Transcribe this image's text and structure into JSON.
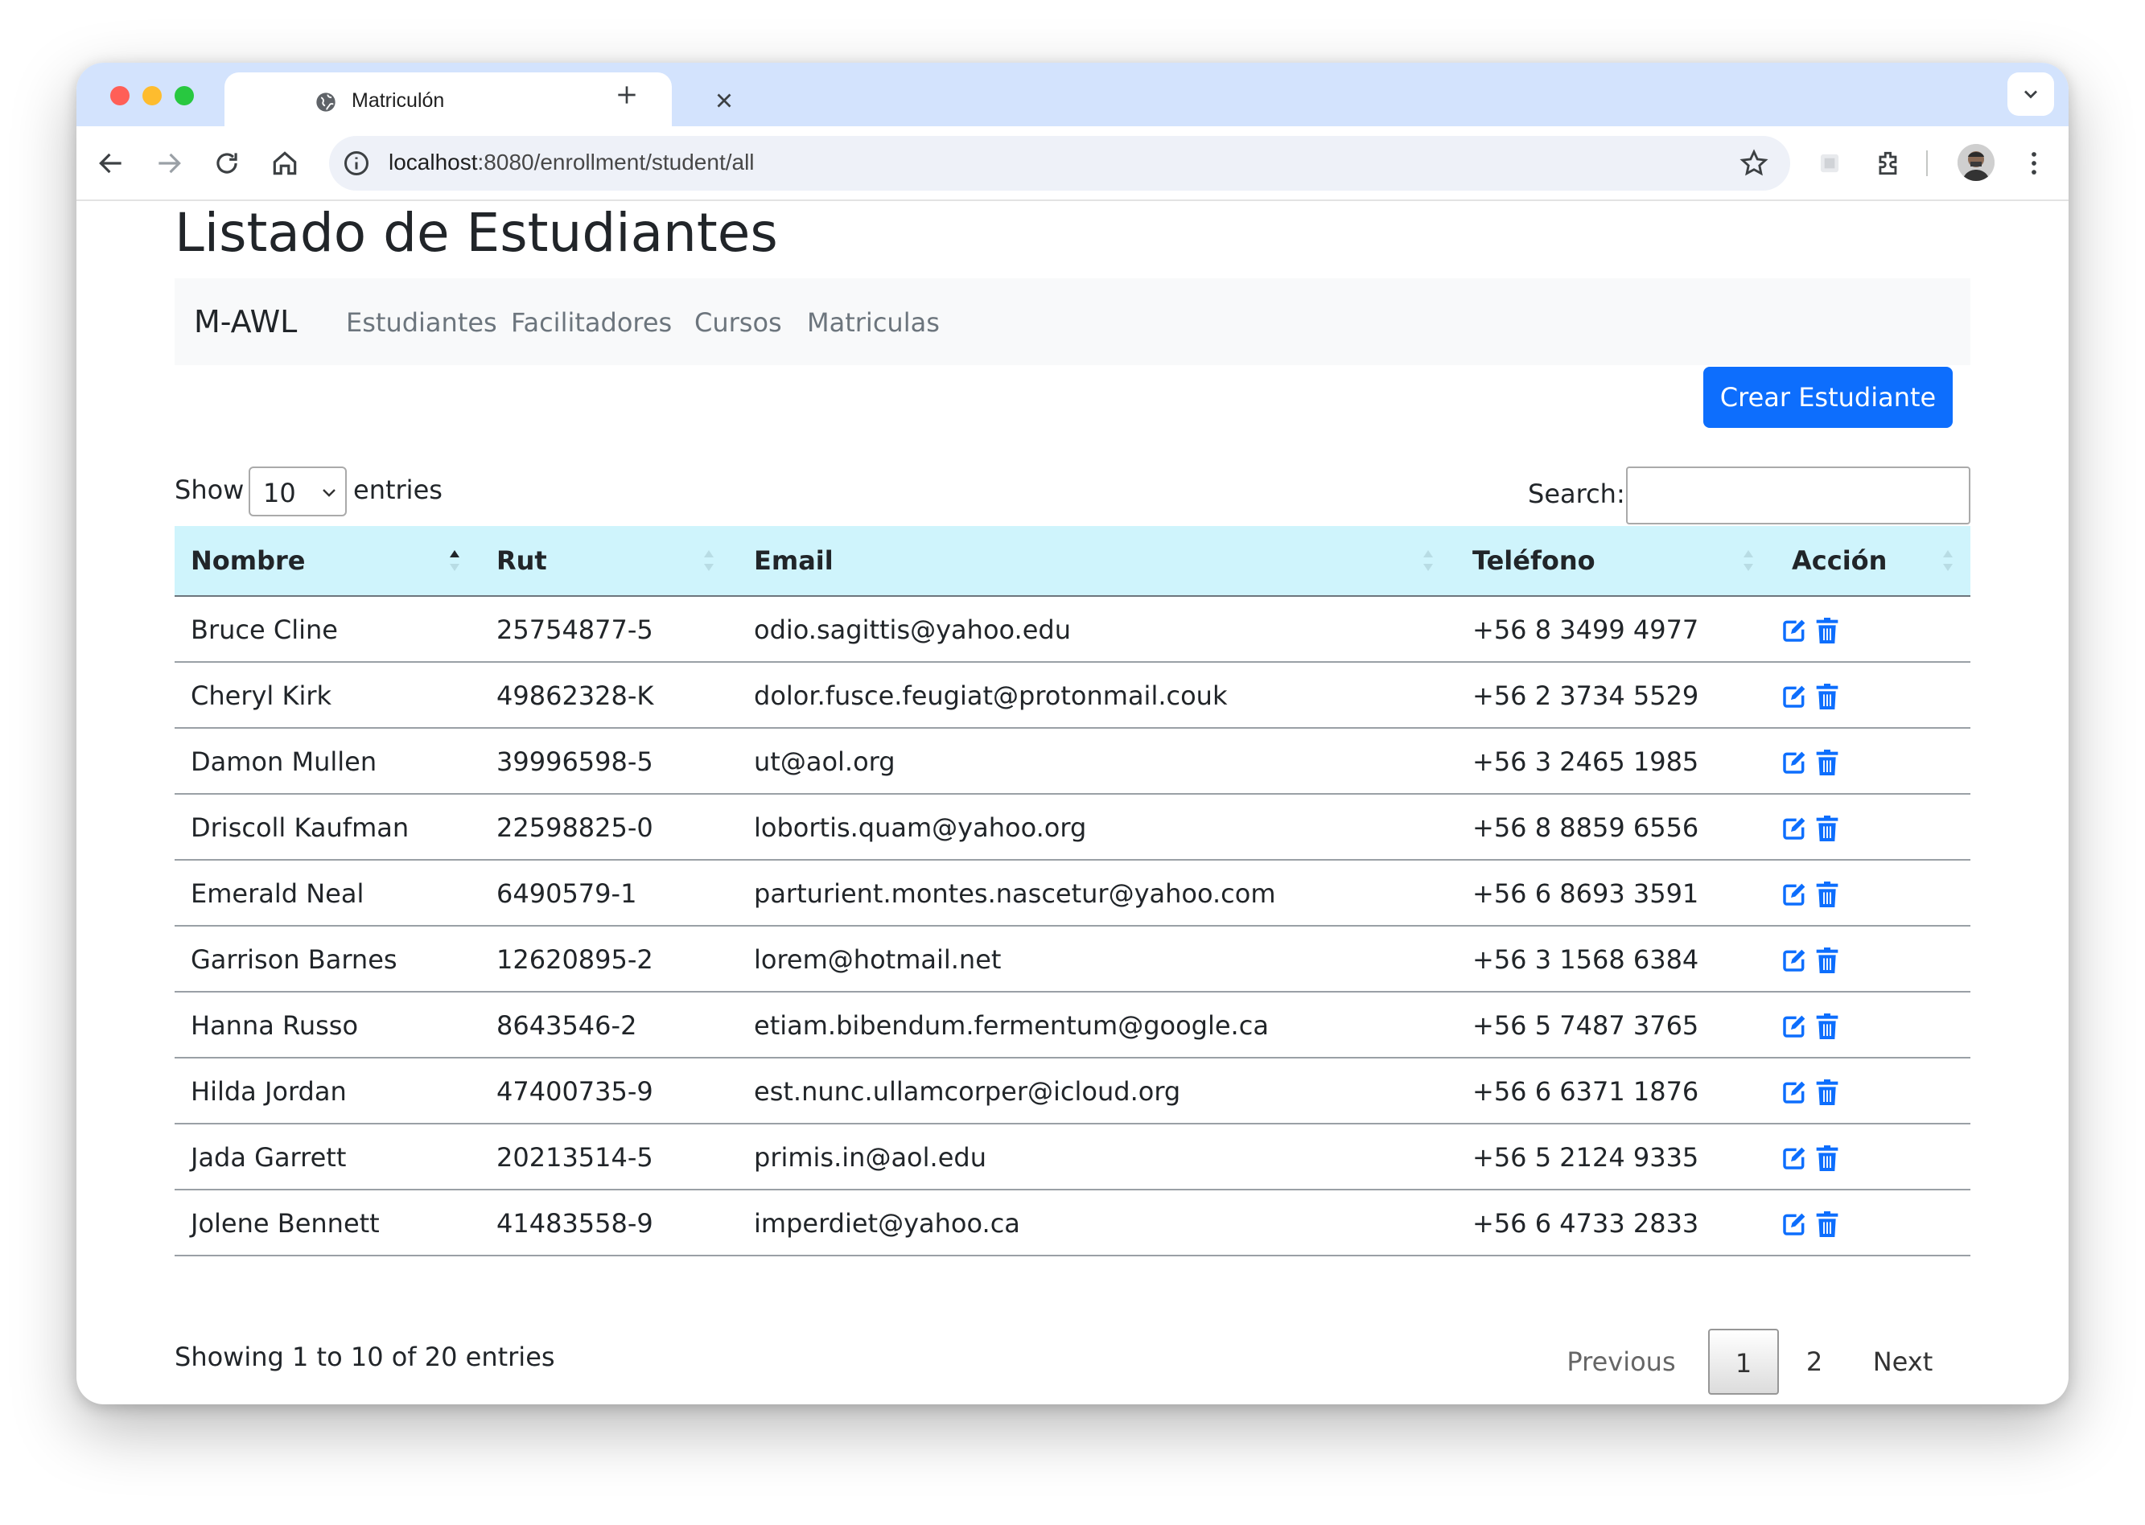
{
  "browser": {
    "tab_title": "Matriculón",
    "url_host": "localhost",
    "url_path": ":8080/enrollment/student/all"
  },
  "page": {
    "title": "Listado de Estudiantes"
  },
  "navbar": {
    "brand": "M-AWL",
    "links": [
      "Estudiantes",
      "Facilitadores",
      "Cursos",
      "Matriculas"
    ]
  },
  "actions": {
    "create_label": "Crear Estudiante"
  },
  "length_menu": {
    "show_label": "Show",
    "value": "10",
    "entries_label": "entries"
  },
  "search": {
    "label": "Search:",
    "value": ""
  },
  "table": {
    "columns": [
      "Nombre",
      "Rut",
      "Email",
      "Teléfono",
      "Acción"
    ],
    "sorted_column": "Nombre",
    "sort_direction": "ascending",
    "rows": [
      {
        "nombre": "Bruce Cline",
        "rut": "25754877-5",
        "email": "odio.sagittis@yahoo.edu",
        "telefono": "+56 8 3499 4977"
      },
      {
        "nombre": "Cheryl Kirk",
        "rut": "49862328-K",
        "email": "dolor.fusce.feugiat@protonmail.couk",
        "telefono": "+56 2 3734 5529"
      },
      {
        "nombre": "Damon Mullen",
        "rut": "39996598-5",
        "email": "ut@aol.org",
        "telefono": "+56 3 2465 1985"
      },
      {
        "nombre": "Driscoll Kaufman",
        "rut": "22598825-0",
        "email": "lobortis.quam@yahoo.org",
        "telefono": "+56 8 8859 6556"
      },
      {
        "nombre": "Emerald Neal",
        "rut": "6490579-1",
        "email": "parturient.montes.nascetur@yahoo.com",
        "telefono": "+56 6 8693 3591"
      },
      {
        "nombre": "Garrison Barnes",
        "rut": "12620895-2",
        "email": "lorem@hotmail.net",
        "telefono": "+56 3 1568 6384"
      },
      {
        "nombre": "Hanna Russo",
        "rut": "8643546-2",
        "email": "etiam.bibendum.fermentum@google.ca",
        "telefono": "+56 5 7487 3765"
      },
      {
        "nombre": "Hilda Jordan",
        "rut": "47400735-9",
        "email": "est.nunc.ullamcorper@icloud.org",
        "telefono": "+56 6 6371 1876"
      },
      {
        "nombre": "Jada Garrett",
        "rut": "20213514-5",
        "email": "primis.in@aol.edu",
        "telefono": "+56 5 2124 9335"
      },
      {
        "nombre": "Jolene Bennett",
        "rut": "41483558-9",
        "email": "imperdiet@yahoo.ca",
        "telefono": "+56 6 4733 2833"
      }
    ]
  },
  "footer": {
    "info": "Showing 1 to 10 of 20 entries",
    "pagination": {
      "previous": "Previous",
      "pages": [
        "1",
        "2"
      ],
      "current_page": "1",
      "next": "Next"
    }
  },
  "colors": {
    "primary": "#0d6efd",
    "header_bg": "#cff4fc",
    "tab_strip": "#d3e3fd"
  },
  "icons": {
    "row_actions": [
      "edit-icon",
      "trash-icon"
    ]
  }
}
